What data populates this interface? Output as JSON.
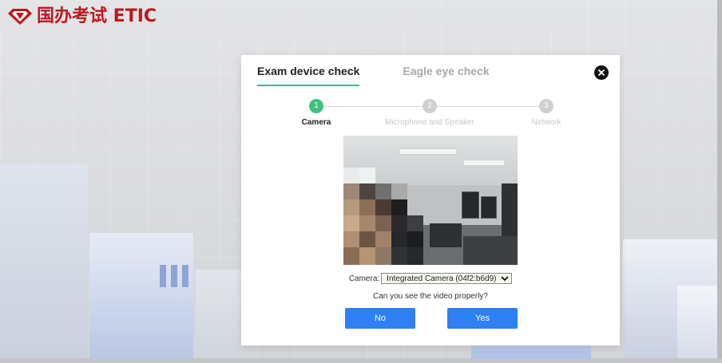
{
  "brand": {
    "logo_text": "国办考试 ETIC",
    "color": "#c0161d"
  },
  "modal": {
    "tabs": [
      {
        "label": "Exam device check",
        "active": true
      },
      {
        "label": "Eagle eye check",
        "active": false
      }
    ],
    "close_icon": "close-icon",
    "steps": [
      {
        "number": "1",
        "label": "Camera",
        "active": true
      },
      {
        "number": "2",
        "label": "Microphone and Speaker",
        "active": false
      },
      {
        "number": "3",
        "label": "Network",
        "active": false
      }
    ],
    "camera": {
      "label": "Camera:",
      "selected": "Integrated Camera (04f2:b6d9)"
    },
    "question": "Can you see the video properly?",
    "buttons": {
      "no": "No",
      "yes": "Yes"
    },
    "accent": "#3dba8c",
    "button_color": "#2f7ff5"
  }
}
